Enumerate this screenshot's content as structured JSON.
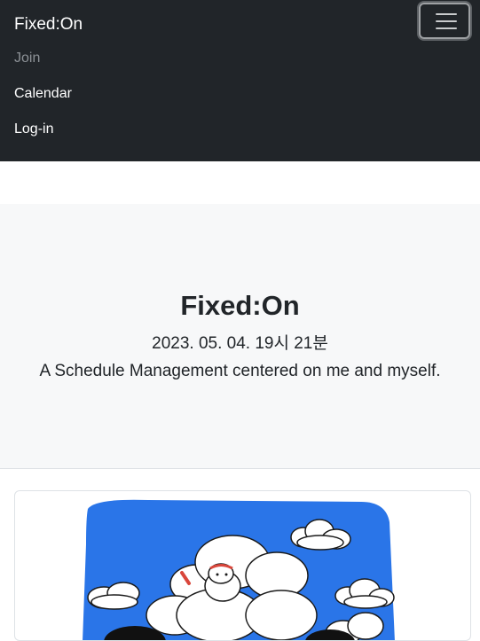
{
  "navbar": {
    "brand": "Fixed:On",
    "toggler_icon": "hamburger-menu-icon",
    "links": [
      {
        "label": "Join"
      },
      {
        "label": "Calendar"
      },
      {
        "label": "Log-in"
      }
    ]
  },
  "hero": {
    "title": "Fixed:On",
    "datetime": "2023. 05. 04. 19시 21분",
    "tagline": "A Schedule Management centered on me and myself."
  },
  "card": {
    "image_icon": "cartoon-character-on-cloud-illustration"
  },
  "colors": {
    "navbar_bg": "#212529",
    "hero_bg": "#f7f8f9",
    "sky_blue": "#2a75e8"
  }
}
